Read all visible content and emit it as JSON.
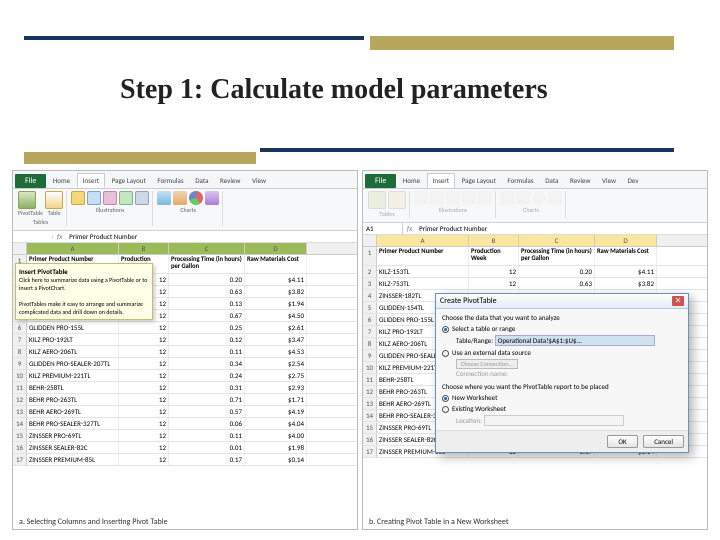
{
  "slide": {
    "title": "Step 1: Calculate model parameters"
  },
  "captions": {
    "a": "a. Selecting Columns and Inserting Pivot Table",
    "b": "b. Creating Pivot Table in a New Worksheet"
  },
  "excel": {
    "file": "File",
    "tabs": [
      "Home",
      "Insert",
      "Page Layout",
      "Formulas",
      "Data",
      "Review",
      "View",
      "Dev"
    ],
    "active_tab": "Insert",
    "ribbon_groups": {
      "tables": "Tables",
      "illustrations": "Illustrations",
      "charts": "Charts"
    },
    "ribbon_items": {
      "pivottable": "PivotTable",
      "table": "Table",
      "picture": "Picture",
      "clipart": "Clip\nArt",
      "shapes": "Shapes",
      "smartart": "SmartArt",
      "screenshot": "Screenshot",
      "column": "Column",
      "line": "Line",
      "pie": "Pie",
      "bar": "Bar"
    },
    "namebox_a": "",
    "namebox_b": "A1",
    "fx_value": "Primer Product Number",
    "col_letters": [
      "A",
      "B",
      "C",
      "D"
    ],
    "headers": [
      "Primer Product Number",
      "Production Week",
      "Processing Time (in hours) per Gallon",
      "Raw Materials Cost"
    ],
    "rows": [
      {
        "n": 2,
        "a": "KILZ-153TL",
        "b": 12,
        "c": "0.20",
        "d": "$4.11"
      },
      {
        "n": 3,
        "a": "KILZ-753TL",
        "b": 12,
        "c": "0.63",
        "d": "$3.82"
      },
      {
        "n": 4,
        "a": "ZINSSER-182TL",
        "b": 12,
        "c": "0.13",
        "d": "$1.94"
      },
      {
        "n": 5,
        "a": "GLIDDEN-154TL",
        "b": 12,
        "c": "0.67",
        "d": "$4.50"
      },
      {
        "n": 6,
        "a": "GLIDDEN PRO-155L",
        "b": 12,
        "c": "0.25",
        "d": "$2.61"
      },
      {
        "n": 7,
        "a": "KILZ PRO-192LT",
        "b": 12,
        "c": "0.12",
        "d": "$3.47"
      },
      {
        "n": 8,
        "a": "KILZ AERO-206TL",
        "b": 12,
        "c": "0.11",
        "d": "$4.53"
      },
      {
        "n": 9,
        "a": "GLIDDEN PRO-SEALER-207TL",
        "b": 12,
        "c": "0.34",
        "d": "$2.54"
      },
      {
        "n": 10,
        "a": "KILZ PREMIUM-221TL",
        "b": 12,
        "c": "0.24",
        "d": "$2.75"
      },
      {
        "n": 11,
        "a": "BEHR-258TL",
        "b": 12,
        "c": "0.31",
        "d": "$2.93"
      },
      {
        "n": 12,
        "a": "BEHR PRO-263TL",
        "b": 12,
        "c": "0.71",
        "d": "$1.71"
      },
      {
        "n": 13,
        "a": "BEHR AERO-269TL",
        "b": 12,
        "c": "0.57",
        "d": "$4.19"
      },
      {
        "n": 14,
        "a": "BEHR PRO-SEALER-327TL",
        "b": 12,
        "c": "0.06",
        "d": "$4.04"
      },
      {
        "n": 15,
        "a": "ZINSSER PRO-69TL",
        "b": 12,
        "c": "0.11",
        "d": "$4.00"
      },
      {
        "n": 16,
        "a": "ZINSSER SEALER-82C",
        "b": 12,
        "c": "0.01",
        "d": "$1.98"
      },
      {
        "n": 17,
        "a": "ZINSSER PREMIUM-85L",
        "b": 12,
        "c": "0.17",
        "d": "$0.14"
      }
    ]
  },
  "pivot_tooltip": {
    "title": "Insert PivotTable",
    "line1": "Click here to summarize data using a PivotTable or to insert a PivotChart.",
    "line2": "PivotTables make it easy to arrange and summarize complicated data and drill down on details."
  },
  "dialog": {
    "title": "Create PivotTable",
    "choose_data": "Choose the data that you want to analyze",
    "opt_select": "Select a table or range",
    "table_range_label": "Table/Range:",
    "table_range_value": "Operational Data!$A$1:$U$...",
    "opt_external": "Use an external data source",
    "choose_conn": "Choose Connection...",
    "conn_name": "Connection name:",
    "choose_place": "Choose where you want the PivotTable report to be placed",
    "opt_new": "New Worksheet",
    "opt_existing": "Existing Worksheet",
    "location": "Location:",
    "ok": "OK",
    "cancel": "Cancel"
  }
}
